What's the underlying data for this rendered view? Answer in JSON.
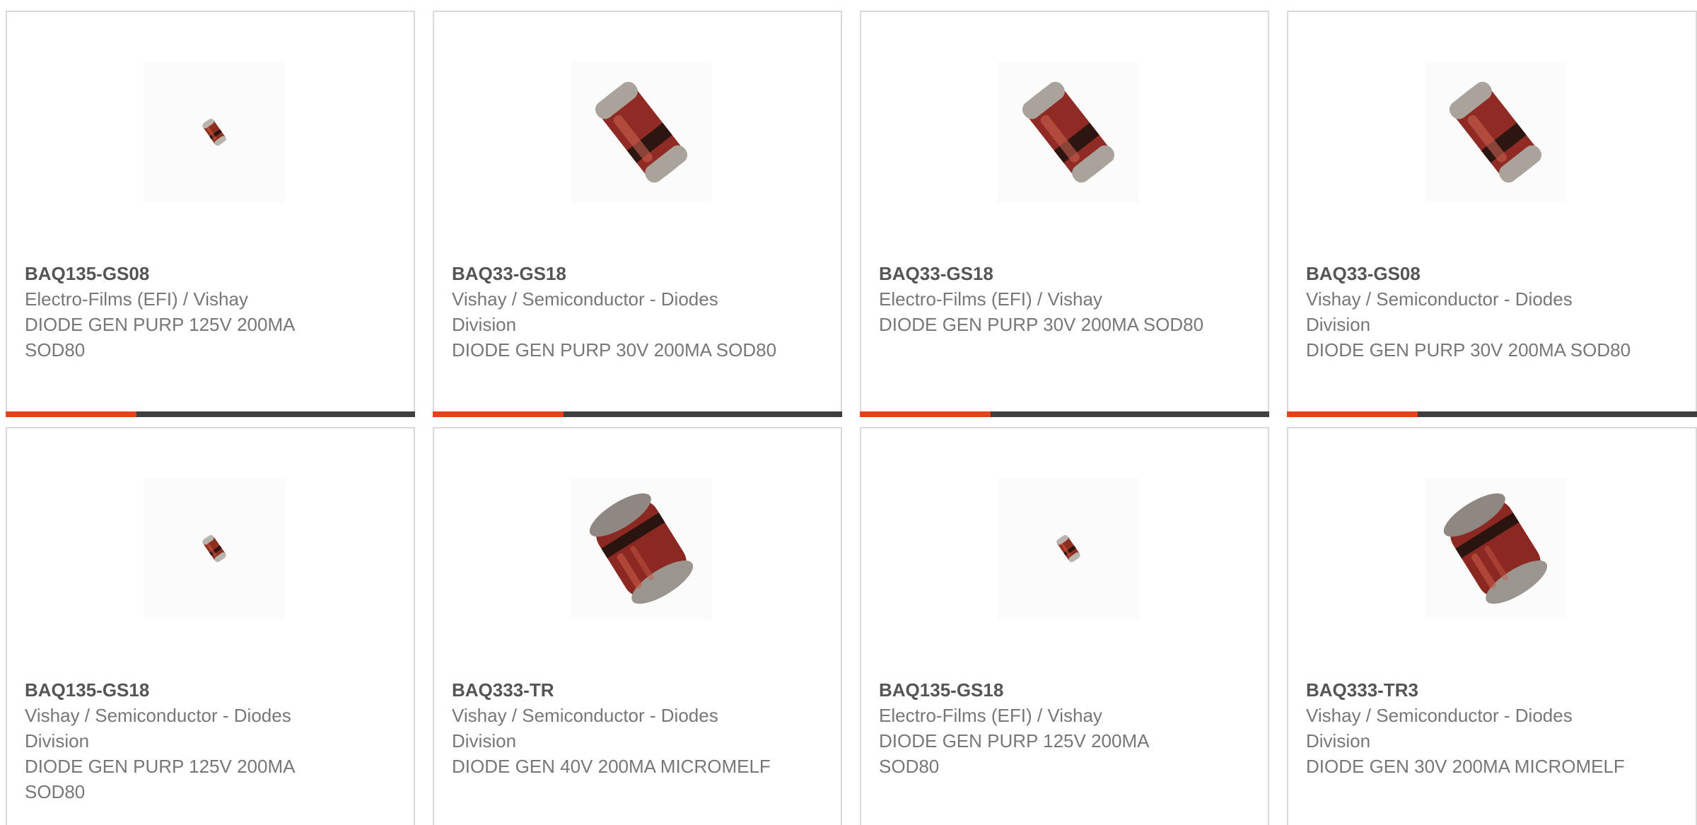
{
  "colors": {
    "accent": "#e8401a",
    "bar": "#3f3f3f",
    "border": "#d9d9d9",
    "text": "#777777",
    "part_text": "#555555"
  },
  "products": [
    {
      "part_number": "BAQ135-GS08",
      "manufacturer": "Electro-Films (EFI) / Vishay",
      "description": "DIODE GEN PURP 125V 200MA SOD80",
      "image": "small-sod80-diode-icon"
    },
    {
      "part_number": "BAQ33-GS18",
      "manufacturer": "Vishay / Semiconductor - Diodes Division",
      "description": "DIODE GEN PURP 30V 200MA SOD80",
      "image": "large-sod80-diode-icon"
    },
    {
      "part_number": "BAQ33-GS18",
      "manufacturer": "Electro-Films (EFI) / Vishay",
      "description": "DIODE GEN PURP 30V 200MA SOD80",
      "image": "large-sod80-diode-icon"
    },
    {
      "part_number": "BAQ33-GS08",
      "manufacturer": "Vishay / Semiconductor - Diodes Division",
      "description": "DIODE GEN PURP 30V 200MA SOD80",
      "image": "large-sod80-diode-icon"
    },
    {
      "part_number": "BAQ135-GS18",
      "manufacturer": "Vishay / Semiconductor - Diodes Division",
      "description": "DIODE GEN PURP 125V 200MA SOD80",
      "image": "small-sod80-diode-icon"
    },
    {
      "part_number": "BAQ333-TR",
      "manufacturer": "Vishay / Semiconductor - Diodes Division",
      "description": "DIODE GEN 40V 200MA MICROMELF",
      "image": "micromelf-diode-icon"
    },
    {
      "part_number": "BAQ135-GS18",
      "manufacturer": "Electro-Films (EFI) / Vishay",
      "description": "DIODE GEN PURP 125V 200MA SOD80",
      "image": "small-sod80-diode-icon"
    },
    {
      "part_number": "BAQ333-TR3",
      "manufacturer": "Vishay / Semiconductor - Diodes Division",
      "description": "DIODE GEN 30V 200MA MICROMELF",
      "image": "micromelf-diode-icon"
    }
  ]
}
